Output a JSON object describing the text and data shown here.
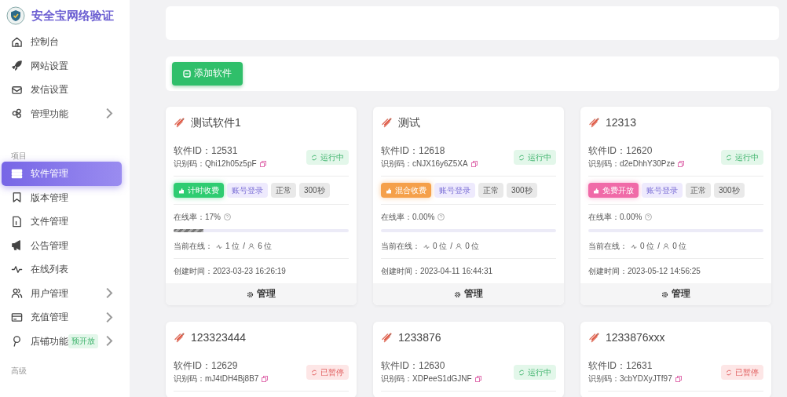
{
  "sidebar": {
    "brand": "安全宝网络验证",
    "groups": [
      {
        "items": [
          {
            "label": "控制台",
            "selected": false,
            "expandable": false
          },
          {
            "label": "网站设置",
            "selected": false,
            "expandable": false
          },
          {
            "label": "发信设置",
            "selected": false,
            "expandable": false
          },
          {
            "label": "管理功能",
            "selected": false,
            "expandable": true
          }
        ]
      },
      {
        "heading": "项目",
        "items": [
          {
            "label": "软件管理",
            "selected": true,
            "expandable": false
          },
          {
            "label": "版本管理",
            "selected": false,
            "expandable": false
          },
          {
            "label": "文件管理",
            "selected": false,
            "expandable": false
          },
          {
            "label": "公告管理",
            "selected": false,
            "expandable": false
          },
          {
            "label": "在线列表",
            "selected": false,
            "expandable": false
          },
          {
            "label": "用户管理",
            "selected": false,
            "expandable": true
          },
          {
            "label": "充值管理",
            "selected": false,
            "expandable": true
          },
          {
            "label": "店铺功能",
            "selected": false,
            "expandable": true,
            "badge": "预开放"
          }
        ]
      },
      {
        "heading": "高级"
      }
    ]
  },
  "toolbar": {
    "add_button": "添加软件"
  },
  "cards": [
    {
      "name": "测试软件1",
      "id_text": "软件ID：12531",
      "code_text": "识别码：Qhi12h05z5pF",
      "status": {
        "kind": "running",
        "label": "运行中"
      },
      "billing": {
        "kind": "timed",
        "label": "计时收费"
      },
      "tags": [
        "账号登录",
        "正常",
        "300秒"
      ],
      "rate_text": "在线率：17%",
      "level": 0.17,
      "online_label": "当前在线：",
      "online_now": "1 位",
      "separator": "/",
      "online_total": "6 位",
      "created": "创建时间：2023-03-23 16:26:19",
      "manage": "管理"
    },
    {
      "name": "测试",
      "id_text": "软件ID：12618",
      "code_text": "识别码：cNJX16y6Z5XA",
      "status": {
        "kind": "running",
        "label": "运行中"
      },
      "billing": {
        "kind": "mixed",
        "label": "混合收费"
      },
      "tags": [
        "账号登录",
        "正常",
        "300秒"
      ],
      "rate_text": "在线率：0.00%",
      "level": 0,
      "online_label": "当前在线：",
      "online_now": "0 位",
      "separator": "/",
      "online_total": "0 位",
      "created": "创建时间：2023-04-11 16:44:31",
      "manage": "管理"
    },
    {
      "name": "12313",
      "id_text": "软件ID：12620",
      "code_text": "识别码：d2eDhhY30Pze",
      "status": {
        "kind": "running",
        "label": "运行中"
      },
      "billing": {
        "kind": "free",
        "label": "免费开放"
      },
      "tags": [
        "账号登录",
        "正常",
        "300秒"
      ],
      "rate_text": "在线率：0.00%",
      "level": 0,
      "online_label": "当前在线：",
      "online_now": "0 位",
      "separator": "/",
      "online_total": "0 位",
      "created": "创建时间：2023-05-12 14:56:25",
      "manage": "管理"
    },
    {
      "name": "123323444",
      "id_text": "软件ID：12629",
      "code_text": "识别码：mJ4tDH4Bj8B7",
      "status": {
        "kind": "paused",
        "label": "已暂停"
      }
    },
    {
      "name": "1233876",
      "id_text": "软件ID：12630",
      "code_text": "识别码：XDPeeS1dGJNF",
      "status": {
        "kind": "running",
        "label": "运行中"
      }
    },
    {
      "name": "1233876xxx",
      "id_text": "软件ID：12631",
      "code_text": "识别码：3cbYDXyJTf97",
      "status": {
        "kind": "paused",
        "label": "已暂停"
      }
    }
  ]
}
